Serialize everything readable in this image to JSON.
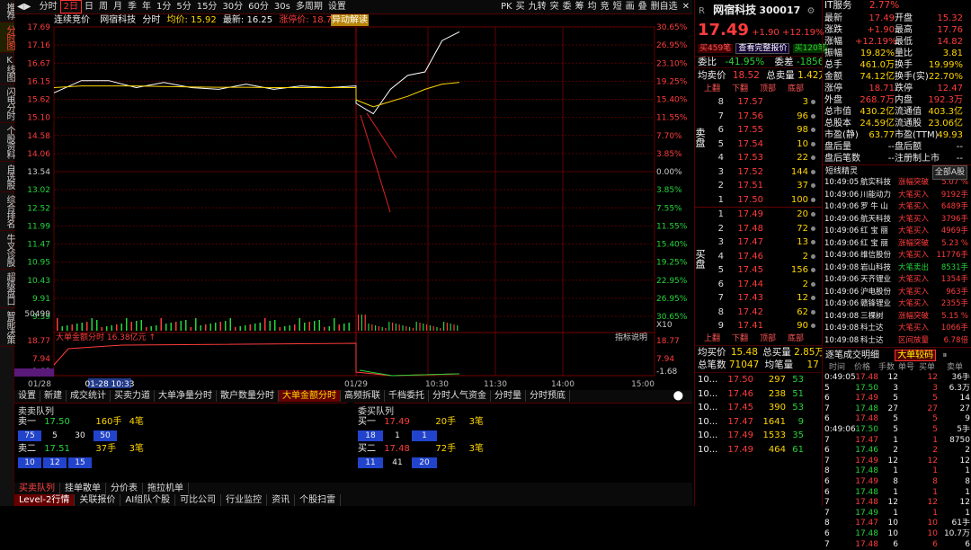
{
  "leftbar": [
    "推荐",
    "分时图",
    "K线图",
    "闪电分时",
    "个股资料",
    "自选股",
    "综合排名",
    "牛叉诊股",
    "超级盘口",
    "智能决策"
  ],
  "toolbar": [
    "分时",
    "2日",
    "日",
    "周",
    "月",
    "季",
    "年",
    "1分",
    "5分",
    "15分",
    "30分",
    "60分",
    "30s",
    "多周期",
    "设置"
  ],
  "toolbar_sel": "2日",
  "toolbar_right": [
    "PK",
    "买",
    "九转",
    "突",
    "委",
    "筹",
    "均",
    "竞",
    "短",
    "画",
    "叠",
    "删自选"
  ],
  "chartinfo": {
    "a": "连续竞价",
    "b": "网宿科技",
    "c": "分时",
    "d": "均价: 15.92",
    "e": "最新: 16.25",
    "f": "涨停价: 18.71"
  },
  "abnormal": "异动解读",
  "chart_data": {
    "type": "line",
    "title": "网宿科技 分时",
    "series": [
      {
        "name": "价格",
        "color": "#ffffff",
        "x": [
          "01-28 09:30",
          "01-28 09:40",
          "01-28 10:00",
          "01-28 10:20",
          "01-28 10:40",
          "01-28 11:00",
          "01-28 11:30",
          "01-28 13:00",
          "01-28 13:30",
          "01-28 14:00",
          "01-28 14:30",
          "01-28 15:00",
          "01-29 09:30",
          "01-29 09:35",
          "01-29 09:45",
          "01-29 10:00",
          "01-29 10:15",
          "01-29 10:30",
          "01-29 10:33"
        ],
        "values": [
          15.8,
          16.15,
          16.15,
          15.95,
          16.1,
          15.95,
          15.9,
          16.05,
          15.9,
          16.0,
          15.95,
          16.0,
          15.5,
          15.2,
          15.9,
          16.3,
          16.4,
          17.3,
          17.55
        ]
      },
      {
        "name": "均价",
        "color": "#ffd600",
        "values": [
          15.95,
          16.0,
          16.0,
          16.0,
          15.98,
          15.97,
          15.96,
          15.96,
          15.95,
          15.95,
          15.95,
          15.95,
          15.6,
          15.4,
          15.55,
          15.7,
          15.9,
          16.05,
          16.1
        ]
      }
    ],
    "yleft": [
      "17.69",
      "17.16",
      "16.67",
      "16.15",
      "15.62",
      "15.10",
      "14.58",
      "14.06",
      "13.54",
      "13.02",
      "12.52",
      "11.99",
      "11.47",
      "10.95",
      "10.43",
      "9.91",
      "9.39"
    ],
    "yright": [
      "30.65%",
      "26.95%",
      "23.10%",
      "19.25%",
      "15.40%",
      "11.55%",
      "7.70%",
      "3.85%",
      "0.00%",
      "3.85%",
      "7.55%",
      "11.55%",
      "15.40%",
      "19.25%",
      "22.95%",
      "26.95%",
      "30.65%"
    ],
    "xticks": [
      "01/28",
      "01-28 10:33",
      "01/29",
      "10:30",
      "11:30",
      "14:00",
      "15:00"
    ],
    "volume_label": "50499",
    "vol_right": "X10",
    "money_top": "18.77",
    "money_mid": "7.94",
    "money_low": "-1.68",
    "money_title": "大单金额分时",
    "money_value": "16.38亿元",
    "indicator": "指标说明"
  },
  "bottomtabs": [
    "设置",
    "新建",
    "成交统计",
    "买卖力道",
    "大单净量分时",
    "散户数量分时",
    "大单金额分时",
    "高频拆联",
    "千档委托",
    "分时人气资金",
    "分时量",
    "分时预底"
  ],
  "bottom_sel": "大单金额分时",
  "sellq": {
    "title": "卖卖队列",
    "r1": {
      "k": "卖一",
      "p": "17.50",
      "s": "160手",
      "n": "4笔",
      "boxes": [
        "75",
        "5",
        "30",
        "50"
      ]
    },
    "r2": {
      "k": "卖二",
      "p": "17.51",
      "s": "37手",
      "n": "3笔",
      "boxes": [
        "10",
        "12",
        "15"
      ]
    }
  },
  "buyq": {
    "title": "委买队列",
    "r1": {
      "k": "买一",
      "p": "17.49",
      "s": "20手",
      "n": "3笔",
      "boxes": [
        "18",
        "1",
        "1"
      ]
    },
    "r2": {
      "k": "买二",
      "p": "17.48",
      "s": "72手",
      "n": "3笔",
      "boxes": [
        "11",
        "41",
        "20"
      ]
    }
  },
  "footer1": [
    "买卖队列",
    "挂单散单",
    "分价表",
    "拖拉机单"
  ],
  "footer2": [
    "Level-2行情",
    "关联报价",
    "AI组队个股",
    "可比公司",
    "行业监控",
    "资讯",
    "个股扫雷"
  ],
  "stock": {
    "name": "网宿科技",
    "code": "300017",
    "price": "17.49",
    "change": "+1.90",
    "pct": "+12.19%",
    "it": "IT服务",
    "it_pct": "2.77%",
    "buy_badge": "买459笔",
    "depth": "查看完整报价",
    "sell_badge": "买120笔"
  },
  "summary": [
    [
      "最新",
      "17.49",
      "开盘",
      "15.32"
    ],
    [
      "涨跌",
      "+1.90",
      "最高",
      "17.76"
    ],
    [
      "涨幅",
      "+12.19%",
      "最低",
      "14.82"
    ],
    [
      "振幅",
      "19.82%",
      "量比",
      "3.81"
    ],
    [
      "总手",
      "461.0万",
      "换手",
      "19.99%"
    ],
    [
      "金额",
      "74.12亿",
      "换手(实)",
      "22.70%"
    ],
    [
      "涨停",
      "18.71",
      "跌停",
      "12.47"
    ],
    [
      "外盘",
      "268.7万",
      "内盘",
      "192.3万"
    ],
    [
      "总市值",
      "430.2亿",
      "流通值",
      "403.3亿"
    ],
    [
      "总股本",
      "24.59亿",
      "流通股",
      "23.06亿"
    ],
    [
      "市盈(静)",
      "63.77",
      "市盈(TTM)",
      "49.93"
    ],
    [
      "盘后量",
      "--",
      "盘后额",
      "--"
    ],
    [
      "盘后笔数",
      "--",
      "注册制上市",
      "--"
    ]
  ],
  "weibi": {
    "k1": "委比",
    "v1": "-41.95%",
    "k2": "委差",
    "v2": "-185677"
  },
  "avgsell": {
    "k1": "均卖价",
    "v1": "18.52",
    "k2": "总卖量",
    "v2": "1.42万"
  },
  "olhead": [
    "上翻",
    "下翻",
    "顶部",
    "底部"
  ],
  "sells": [
    [
      "8",
      "17.57",
      "3"
    ],
    [
      "7",
      "17.56",
      "96"
    ],
    [
      "6",
      "17.55",
      "98"
    ],
    [
      "5",
      "17.54",
      "10"
    ],
    [
      "4",
      "17.53",
      "22"
    ],
    [
      "3",
      "17.52",
      "144"
    ],
    [
      "2",
      "17.51",
      "37"
    ],
    [
      "1",
      "17.50",
      "100"
    ]
  ],
  "buys": [
    [
      "1",
      "17.49",
      "20"
    ],
    [
      "2",
      "17.48",
      "72"
    ],
    [
      "3",
      "17.47",
      "13"
    ],
    [
      "4",
      "17.46",
      "2"
    ],
    [
      "5",
      "17.45",
      "156"
    ],
    [
      "6",
      "17.44",
      "2"
    ],
    [
      "7",
      "17.43",
      "12"
    ],
    [
      "8",
      "17.42",
      "62"
    ],
    [
      "9",
      "17.41",
      "90"
    ]
  ],
  "sell_label": "卖盘",
  "buy_label": "买盘",
  "avgbuy": {
    "k1": "均买价",
    "v1": "15.48",
    "k2": "总买量",
    "v2": "2.85万"
  },
  "totalcnt": {
    "k1": "总笔数",
    "v1": "71047",
    "k2": "均笔量",
    "v2": "17"
  },
  "bottomtrades": [
    [
      "10...",
      "17.50",
      "297",
      "53"
    ],
    [
      "10...",
      "17.46",
      "238",
      "51"
    ],
    [
      "10...",
      "17.45",
      "390",
      "53"
    ],
    [
      "10...",
      "17.47",
      "1641",
      "9"
    ],
    [
      "10...",
      "17.49",
      "1533",
      "35"
    ],
    [
      "10...",
      "17.49",
      "464",
      "61"
    ]
  ],
  "sprite_title": "短线精灵",
  "sprite_scope": "全部A股",
  "sprites": [
    [
      "10:49:05",
      "航实科技",
      "涨幅突破",
      "5.07 %"
    ],
    [
      "10:49:06",
      "川能动力",
      "大笔买入",
      "9192手"
    ],
    [
      "10:49:06",
      "罗 牛 山",
      "大笔买入",
      "6489手"
    ],
    [
      "10:49:06",
      "航天科技",
      "大笔买入",
      "3796手"
    ],
    [
      "10:49:06",
      "红 宝 丽",
      "大笔买入",
      "4969手"
    ],
    [
      "10:49:06",
      "红 宝 丽",
      "涨幅突破",
      "5.23 %"
    ],
    [
      "10:49:06",
      "维信股份",
      "大笔买入",
      "11776手"
    ],
    [
      "10:49:08",
      "岩山科技",
      "大笔卖出",
      "8531手"
    ],
    [
      "10:49:06",
      "天齐锂业",
      "大笔买入",
      "1354手"
    ],
    [
      "10:49:06",
      "沪电股份",
      "大笔买入",
      "963手"
    ],
    [
      "10:49:06",
      "赣锋锂业",
      "大笔买入",
      "2355手"
    ],
    [
      "10:49:08",
      "三棵树",
      "涨幅突破",
      "5.15 %"
    ],
    [
      "10:49:08",
      "科士达",
      "大笔买入",
      "1066手"
    ],
    [
      "10:49:08",
      "科士达",
      "区间放量",
      "6.78倍"
    ]
  ],
  "deal_title": "逐笔成交明细",
  "deal_btn": "大单较码",
  "deal_head": [
    "时间",
    "价格",
    "手数",
    "单号",
    "买单",
    "卖单"
  ],
  "deals": [
    [
      "0:49:05",
      "17.48",
      "12",
      "",
      "12",
      "36手"
    ],
    [
      "5",
      "17.50",
      "3",
      "",
      "3",
      "6.3万"
    ],
    [
      "6",
      "17.49",
      "5",
      "",
      "5",
      "14"
    ],
    [
      "7",
      "17.48",
      "27",
      "",
      "27",
      "27"
    ],
    [
      "6",
      "17.48",
      "5",
      "",
      "5",
      "9"
    ],
    [
      "0:49:06",
      "17.50",
      "5",
      "",
      "5",
      "5手"
    ],
    [
      "7",
      "17.47",
      "1",
      "",
      "1",
      "8750"
    ],
    [
      "6",
      "17.46",
      "2",
      "",
      "2",
      "2"
    ],
    [
      "7",
      "17.49",
      "12",
      "",
      "12",
      "12"
    ],
    [
      "8",
      "17.48",
      "1",
      "",
      "1",
      "1"
    ],
    [
      "6",
      "17.49",
      "8",
      "",
      "8",
      "8"
    ],
    [
      "6",
      "17.48",
      "1",
      "",
      "1",
      "1"
    ],
    [
      "7",
      "17.48",
      "12",
      "",
      "12",
      "12"
    ],
    [
      "7",
      "17.49",
      "1",
      "",
      "1",
      "1"
    ],
    [
      "8",
      "17.47",
      "10",
      "",
      "10",
      "61手"
    ],
    [
      "6",
      "17.48",
      "10",
      "",
      "10",
      "10.7万"
    ],
    [
      "7",
      "17.48",
      "6",
      "",
      "6",
      "6"
    ]
  ]
}
